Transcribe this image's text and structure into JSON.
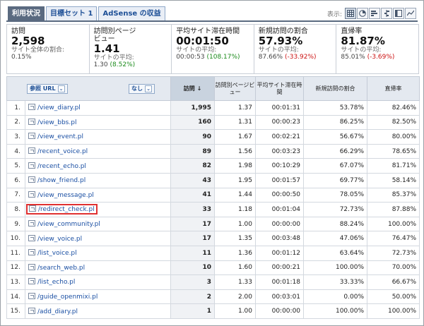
{
  "tabs": [
    {
      "label": "利用状況",
      "active": true
    },
    {
      "label": "目標セット 1",
      "active": false
    },
    {
      "label": "AdSense の収益",
      "active": false
    }
  ],
  "view": {
    "label": "表示:"
  },
  "metrics": [
    {
      "label": "訪問",
      "value": "2,598",
      "sub": "サイト全体の割合:",
      "sub2": "0.15%",
      "delta": ""
    },
    {
      "label": "訪問別ページ\nビュー",
      "value": "1.41",
      "sub": "サイトの平均:",
      "sub2": "1.30",
      "delta": "(8.52%)",
      "delta_kind": "pos"
    },
    {
      "label": "平均サイト滞在時間",
      "value": "00:01:50",
      "sub": "サイトの平均:",
      "sub2": "00:00:53",
      "delta": "(108.17%)",
      "delta_kind": "pos"
    },
    {
      "label": "新規訪問の割合",
      "value": "57.93%",
      "sub": "サイトの平均:",
      "sub2": "87.66%",
      "delta": "(-33.92%)",
      "delta_kind": "neg"
    },
    {
      "label": "直帰率",
      "value": "81.87%",
      "sub": "サイトの平均:",
      "sub2": "85.01%",
      "delta": "(-3.69%)",
      "delta_kind": "neg"
    }
  ],
  "table": {
    "dimension_primary": "参照 URL",
    "dimension_secondary": "なし",
    "headers": {
      "visits": "訪問",
      "pages_per_visit": "訪問別ページビュー",
      "avg_time": "平均サイト滞在時間",
      "new_visits": "新規訪問の割合",
      "bounce": "直帰率"
    },
    "rows": [
      {
        "idx": "1.",
        "page": "/view_diary.pl",
        "visits": "1,995",
        "ppv": "1.37",
        "time": "00:01:31",
        "new": "53.78%",
        "bounce": "82.46%"
      },
      {
        "idx": "2.",
        "page": "/view_bbs.pl",
        "visits": "160",
        "ppv": "1.31",
        "time": "00:00:23",
        "new": "86.25%",
        "bounce": "82.50%"
      },
      {
        "idx": "3.",
        "page": "/view_event.pl",
        "visits": "90",
        "ppv": "1.67",
        "time": "00:02:21",
        "new": "56.67%",
        "bounce": "80.00%"
      },
      {
        "idx": "4.",
        "page": "/recent_voice.pl",
        "visits": "89",
        "ppv": "1.56",
        "time": "00:03:23",
        "new": "66.29%",
        "bounce": "78.65%"
      },
      {
        "idx": "5.",
        "page": "/recent_echo.pl",
        "visits": "82",
        "ppv": "1.98",
        "time": "00:10:29",
        "new": "67.07%",
        "bounce": "81.71%"
      },
      {
        "idx": "6.",
        "page": "/show_friend.pl",
        "visits": "43",
        "ppv": "1.95",
        "time": "00:01:57",
        "new": "69.77%",
        "bounce": "58.14%"
      },
      {
        "idx": "7.",
        "page": "/view_message.pl",
        "visits": "41",
        "ppv": "1.44",
        "time": "00:00:50",
        "new": "78.05%",
        "bounce": "85.37%"
      },
      {
        "idx": "8.",
        "page": "/redirect_check.pl",
        "visits": "33",
        "ppv": "1.18",
        "time": "00:01:04",
        "new": "72.73%",
        "bounce": "87.88%"
      },
      {
        "idx": "9.",
        "page": "/view_community.pl",
        "visits": "17",
        "ppv": "1.00",
        "time": "00:00:00",
        "new": "88.24%",
        "bounce": "100.00%"
      },
      {
        "idx": "10.",
        "page": "/view_voice.pl",
        "visits": "17",
        "ppv": "1.35",
        "time": "00:03:48",
        "new": "47.06%",
        "bounce": "76.47%"
      },
      {
        "idx": "11.",
        "page": "/list_voice.pl",
        "visits": "11",
        "ppv": "1.36",
        "time": "00:01:12",
        "new": "63.64%",
        "bounce": "72.73%"
      },
      {
        "idx": "12.",
        "page": "/search_web.pl",
        "visits": "10",
        "ppv": "1.60",
        "time": "00:00:21",
        "new": "100.00%",
        "bounce": "70.00%"
      },
      {
        "idx": "13.",
        "page": "/list_echo.pl",
        "visits": "3",
        "ppv": "1.33",
        "time": "00:01:18",
        "new": "33.33%",
        "bounce": "66.67%"
      },
      {
        "idx": "14.",
        "page": "/guide_openmixi.pl",
        "visits": "2",
        "ppv": "2.00",
        "time": "00:03:01",
        "new": "0.00%",
        "bounce": "50.00%"
      },
      {
        "idx": "15.",
        "page": "/add_diary.pl",
        "visits": "1",
        "ppv": "1.00",
        "time": "00:00:00",
        "new": "100.00%",
        "bounce": "100.00%"
      }
    ],
    "highlighted_row": 7
  },
  "colors": {
    "accent": "#5a6a80",
    "link": "#1a4fa3",
    "positive": "#1a8a1a",
    "negative": "#cc1111",
    "highlight": "#e03030"
  }
}
